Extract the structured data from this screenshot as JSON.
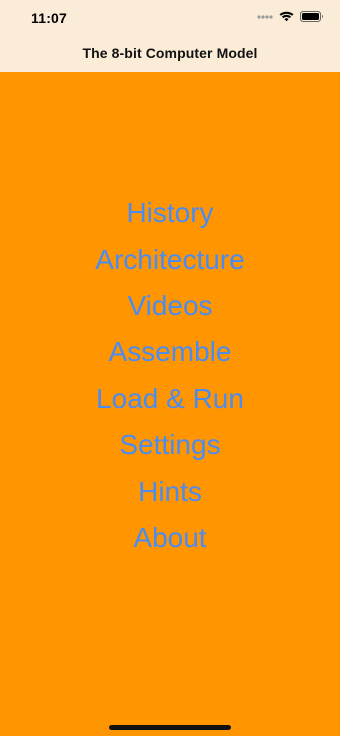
{
  "status_bar": {
    "time": "11:07",
    "icons": [
      "signal-icon",
      "wifi-icon",
      "battery-icon"
    ]
  },
  "nav": {
    "title": "The 8-bit Computer Model"
  },
  "menu": {
    "items": [
      "History",
      "Architecture",
      "Videos",
      "Assemble",
      "Load & Run",
      "Settings",
      "Hints",
      "About"
    ]
  },
  "colors": {
    "background": "#ff9500",
    "header_background": "#fbecd8",
    "menu_text": "#4a8cf2",
    "title_text": "#111111"
  }
}
